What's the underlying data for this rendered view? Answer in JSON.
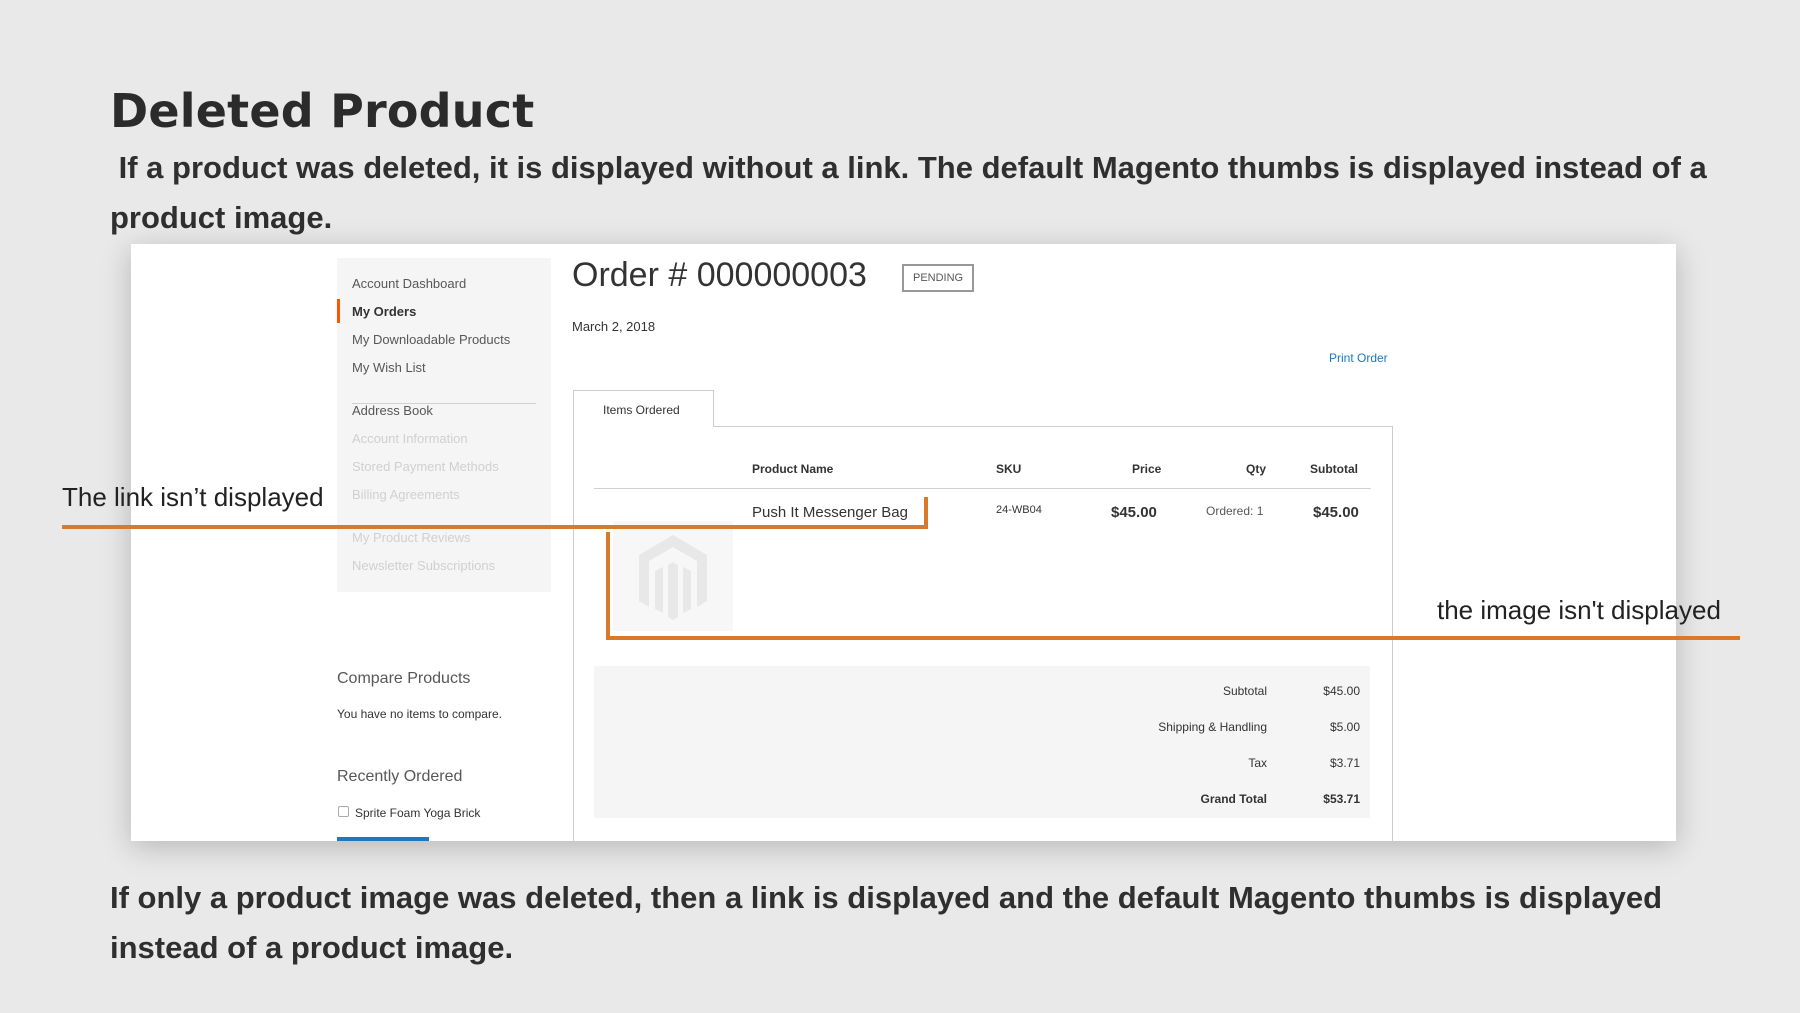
{
  "slide": {
    "title": "Deleted Product",
    "intro": " If a product was deleted, it is displayed without a link. The default Magento thumbs is displayed instead of a product image.",
    "outro": "If only a product image was deleted, then a link is displayed and the default Magento thumbs is displayed instead of a product image."
  },
  "sidebar": {
    "items": [
      {
        "label": "Account Dashboard"
      },
      {
        "label": "My Orders"
      },
      {
        "label": "My Downloadable Products"
      },
      {
        "label": "My Wish List"
      },
      {
        "label": "Address Book"
      },
      {
        "label": "Account Information"
      },
      {
        "label": "Stored Payment Methods"
      },
      {
        "label": "Billing Agreements"
      },
      {
        "label": "My Product Reviews"
      },
      {
        "label": "Newsletter Subscriptions"
      }
    ],
    "compare_title": "Compare Products",
    "compare_text": "You have no items to compare.",
    "recent_title": "Recently Ordered",
    "recent_item": "Sprite Foam Yoga Brick"
  },
  "order": {
    "title": "Order # 000000003",
    "status": "PENDING",
    "date": "March 2, 2018",
    "print_label": "Print Order",
    "tab_label": "Items Ordered",
    "columns": {
      "product": "Product Name",
      "sku": "SKU",
      "price": "Price",
      "qty": "Qty",
      "subtotal": "Subtotal"
    },
    "item": {
      "name": "Push It Messenger Bag",
      "sku": "24-WB04",
      "price": "$45.00",
      "qty": "Ordered: 1",
      "subtotal": "$45.00"
    },
    "totals": [
      {
        "label": "Subtotal",
        "value": "$45.00"
      },
      {
        "label": "Shipping & Handling",
        "value": "$5.00"
      },
      {
        "label": "Tax",
        "value": "$3.71"
      },
      {
        "label": "Grand Total",
        "value": "$53.71"
      }
    ]
  },
  "annotations": {
    "link_note": "The link isn’t displayed",
    "image_note": "the image isn't displayed"
  },
  "colors": {
    "accent": "#d97a2b",
    "active": "#ff5501",
    "link": "#1979c3"
  }
}
